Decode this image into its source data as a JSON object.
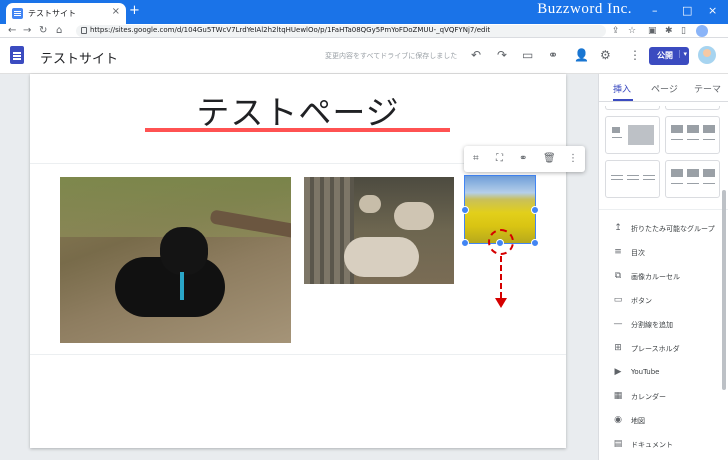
{
  "browser": {
    "tab_title": "テストサイト",
    "tab_close": "×",
    "new_tab": "+",
    "url": "https://sites.google.com/d/104Gu5TWcV7LrdYeIAl2h2ltqHUewlOo/p/1FaHTa08QGy5PmYoFDoZMUU-_qVQFYNj7/edit",
    "watermark": "Buzzword Inc.",
    "win_controls": [
      "–",
      "□",
      "×"
    ],
    "nav_icons": [
      "←",
      "→",
      "↻",
      "⌂"
    ],
    "toolbar_icons": [
      "⇪",
      "☆",
      "▣",
      "✱",
      "▯"
    ]
  },
  "app": {
    "site_name": "テストサイト",
    "save_status": "変更内容をすべてドライブに保存しました",
    "icons": [
      "↶",
      "↷",
      "▭",
      "⚭",
      "👤",
      "⚙",
      "⋮"
    ],
    "publish_label": "公開",
    "publish_caret": "▾"
  },
  "page": {
    "title": "テストページ",
    "title_bar_color": "#ff5252"
  },
  "image_toolbar": {
    "icons": [
      "⌗",
      "⛶",
      "⚭",
      "🗑",
      "⋮"
    ]
  },
  "side_panel": {
    "tabs": [
      "挿入",
      "ページ",
      "テーマ"
    ],
    "items": [
      {
        "icon": "↥",
        "label": "折りたたみ可能なグループ"
      },
      {
        "icon": "≡",
        "label": "目次"
      },
      {
        "icon": "⧉",
        "label": "画像カルーセル"
      },
      {
        "icon": "▭",
        "label": "ボタン"
      },
      {
        "icon": "—",
        "label": "分割線を追加"
      },
      {
        "icon": "⊞",
        "label": "プレースホルダ"
      },
      {
        "icon": "▶",
        "label": "YouTube"
      },
      {
        "icon": "▦",
        "label": "カレンダー"
      },
      {
        "icon": "◉",
        "label": "地図"
      },
      {
        "icon": "▤",
        "label": "ドキュメント"
      }
    ]
  },
  "annotation": {
    "color": "#d50000"
  }
}
